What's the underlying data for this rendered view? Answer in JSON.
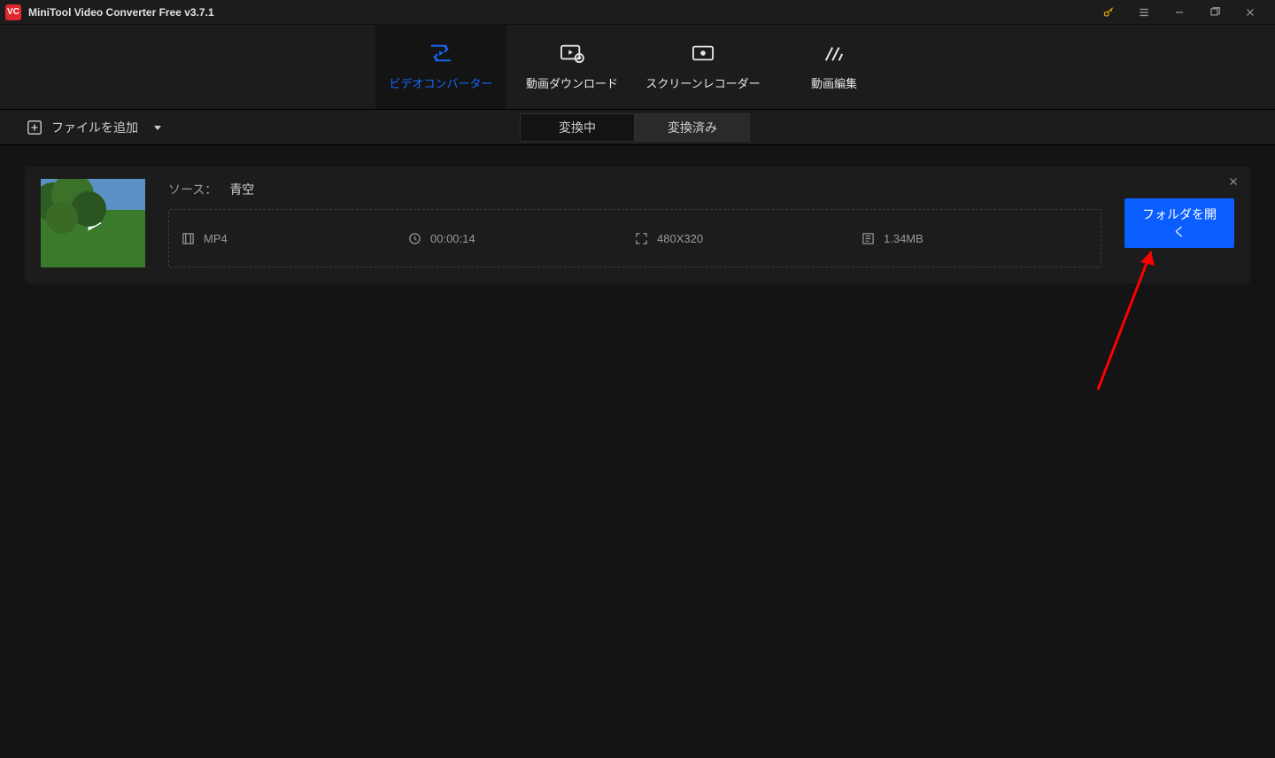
{
  "titlebar": {
    "app_title": "MiniTool Video Converter Free v3.7.1"
  },
  "maintabs": [
    {
      "label": "ビデオコンバーター",
      "icon": "convert-icon",
      "active": true
    },
    {
      "label": "動画ダウンロード",
      "icon": "download-icon",
      "active": false
    },
    {
      "label": "スクリーンレコーダー",
      "icon": "record-icon",
      "active": false
    },
    {
      "label": "動画編集",
      "icon": "edit-icon",
      "active": false
    }
  ],
  "toolbar": {
    "add_file_label": "ファイルを追加",
    "seg_converting": "変換中",
    "seg_converted": "変換済み"
  },
  "card": {
    "source_label": "ソース：",
    "source_value": "青空",
    "format": "MP4",
    "duration": "00:00:14",
    "resolution": "480X320",
    "filesize": "1.34MB",
    "open_folder_label": "フォルダを開く"
  }
}
